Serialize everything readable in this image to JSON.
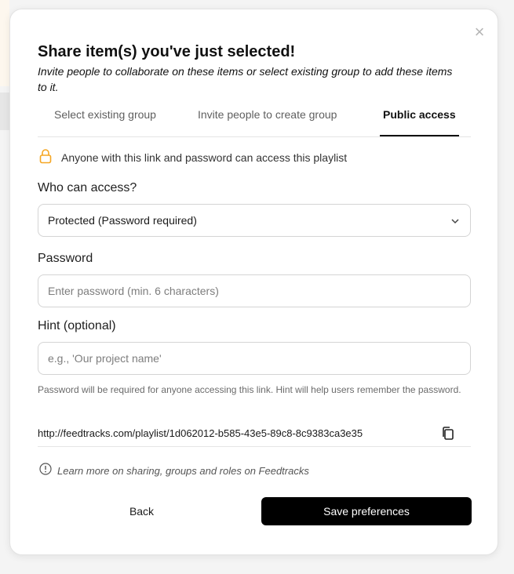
{
  "modal": {
    "title": "Share item(s) you've just selected!",
    "subtitle": "Invite people to collaborate on these items or select existing group to add these items to it.",
    "close_icon": "close-icon"
  },
  "tabs": [
    {
      "label": "Select existing group",
      "active": false
    },
    {
      "label": "Invite people to create group",
      "active": false
    },
    {
      "label": "Public access",
      "active": true
    }
  ],
  "info": {
    "icon": "lock-icon",
    "text": "Anyone with this link and password can access this playlist",
    "icon_color": "#f5a623"
  },
  "access": {
    "label": "Who can access?",
    "selected": "Protected (Password required)"
  },
  "password": {
    "label": "Password",
    "placeholder": "Enter password (min. 6 characters)"
  },
  "hint": {
    "label": "Hint (optional)",
    "placeholder": "e.g., 'Our project name'"
  },
  "note": "Password will be required for anyone accessing this link. Hint will help users remember the password.",
  "share_link": {
    "url": "http://feedtracks.com/playlist/1d062012-b585-43e5-89c8-8c9383ca3e35",
    "copy_icon": "copy-icon"
  },
  "learn_more": {
    "icon": "info-icon",
    "text": "Learn more on sharing, groups and roles on Feedtracks"
  },
  "actions": {
    "back_label": "Back",
    "save_label": "Save preferences"
  }
}
